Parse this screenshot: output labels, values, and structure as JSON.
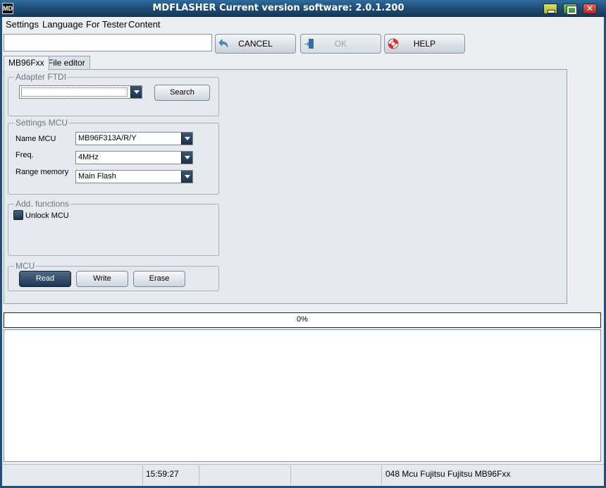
{
  "window": {
    "title": "MDFLASHER  Current version software: 2.0.1.200",
    "app_icon_text": "MD"
  },
  "menu": [
    "Settings",
    "Language",
    "For Tester",
    "Content"
  ],
  "toolbar": {
    "input_value": "",
    "cancel_label": "CANCEL",
    "ok_label": "OK",
    "help_label": "HELP"
  },
  "tabs": [
    {
      "label": "MB96Fxx",
      "active": true
    },
    {
      "label": "File editor",
      "active": false
    }
  ],
  "adapter": {
    "title": "Adapter FTDI",
    "selected": "",
    "search_label": "Search"
  },
  "settings_mcu": {
    "title": "Settings MCU",
    "name_label": "Name MCU",
    "name_value": "MB96F313A/R/Y",
    "freq_label": "Freq.",
    "freq_value": "4MHz",
    "range_label": "Range memory",
    "range_value": "Main Flash"
  },
  "add_functions": {
    "title": "Add. functions",
    "unlock_label": "Unlock MCU",
    "unlock_checked": false
  },
  "mcu": {
    "title": "MCU",
    "read_label": "Read",
    "write_label": "Write",
    "erase_label": "Erase"
  },
  "progress": {
    "value": 0,
    "text": "0%"
  },
  "status": {
    "time": "15:59:27",
    "message": "048 Mcu Fujitsu Fujitsu MB96Fxx"
  },
  "colors": {
    "titlebar": "#1c4a73",
    "progress_fill": "#3b8ede"
  },
  "icons": {
    "cancel": "undo-arrow-icon",
    "ok": "enter-door-icon",
    "help": "lifebuoy-icon"
  }
}
